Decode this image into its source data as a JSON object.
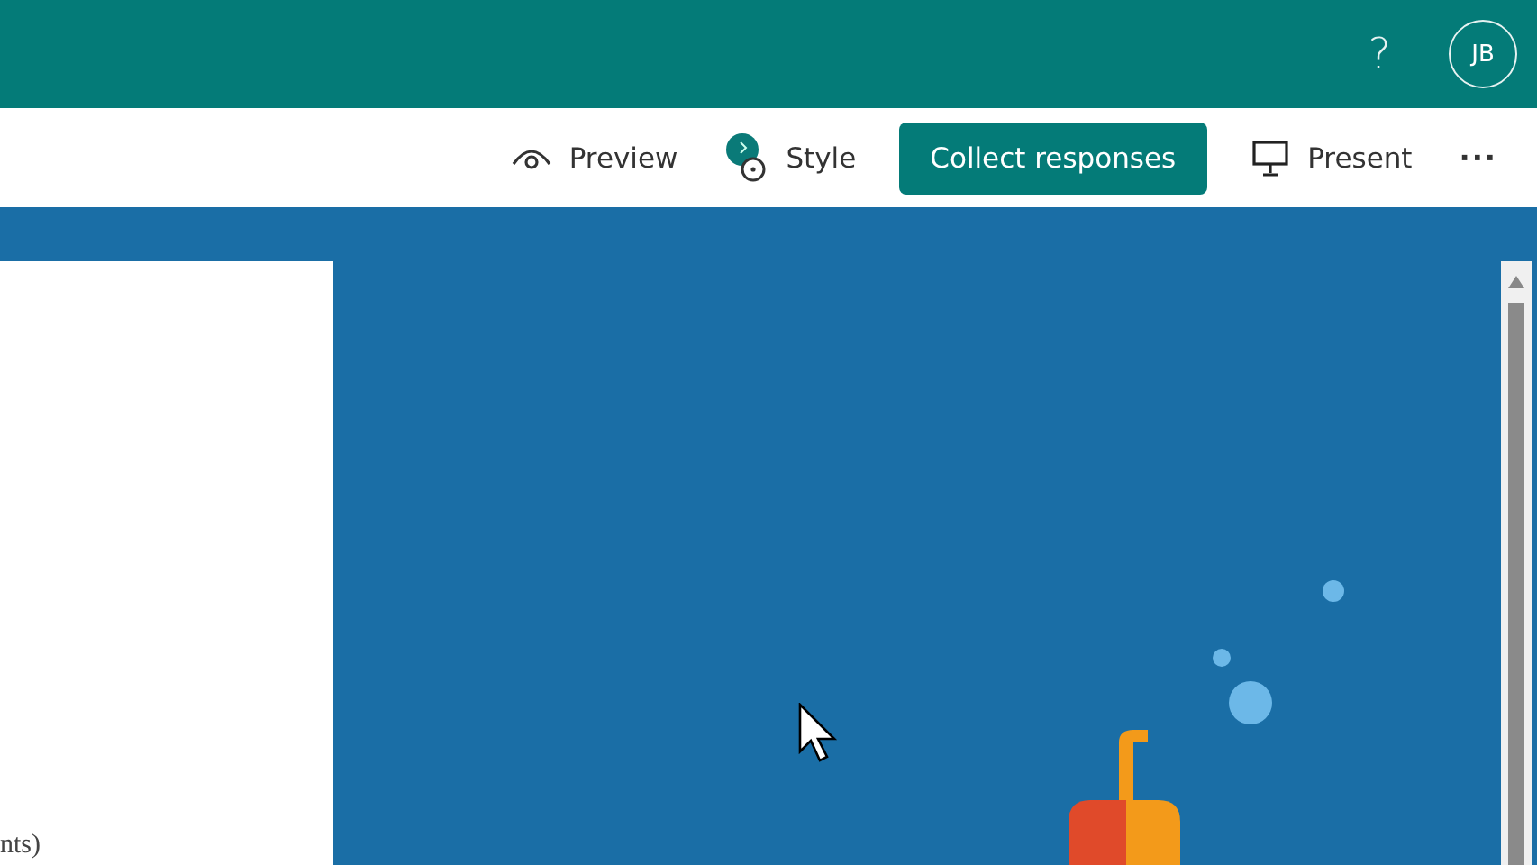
{
  "header": {
    "help": "?",
    "avatar": "JB"
  },
  "toolbar": [
    {
      "kind": "preview",
      "label": "Preview"
    },
    {
      "kind": "style",
      "label": "Style"
    },
    {
      "kind": "primary",
      "label": "Collect responses"
    },
    {
      "kind": "present",
      "label": "Present"
    },
    {
      "kind": "more",
      "label": "···"
    }
  ],
  "form_panel": {
    "text": "nts)"
  }
}
